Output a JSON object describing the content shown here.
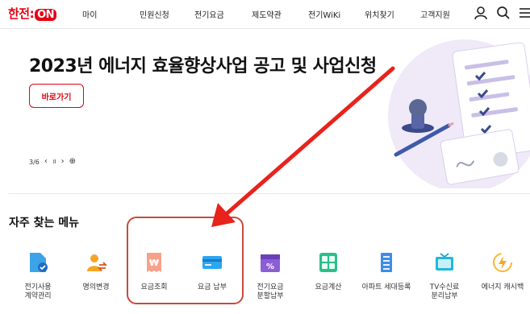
{
  "header": {
    "logo_part1": "한전:",
    "logo_part2": "ON",
    "nav": [
      "마이",
      "민원신청",
      "전기요금",
      "제도약관",
      "전기WiKi",
      "위치찾기",
      "고객지원"
    ],
    "icons": [
      "user-icon",
      "search-icon",
      "menu-icon"
    ]
  },
  "hero": {
    "title": "2023년 에너지 효율향상사업 공고 및 사업신청",
    "button_label": "바로가기",
    "slide_counter": "3/6",
    "controls": {
      "prev": "‹",
      "pause": "॥",
      "next": "›",
      "add": "⊕"
    }
  },
  "frequent_menu": {
    "title": "자주 찾는 메뉴",
    "items": [
      {
        "label": "전기사용\n계약관리",
        "icon": "document-check-icon"
      },
      {
        "label": "명의변경",
        "icon": "user-change-icon"
      },
      {
        "label": "요금조회",
        "icon": "won-receipt-icon"
      },
      {
        "label": "요금 납부",
        "icon": "credit-card-icon"
      },
      {
        "label": "전기요금\n분할납부",
        "icon": "calendar-percent-icon"
      },
      {
        "label": "요금계산",
        "icon": "calculator-icon"
      },
      {
        "label": "아파트 세대등록",
        "icon": "apartment-icon"
      },
      {
        "label": "TV수신료\n분리납부",
        "icon": "tv-icon"
      },
      {
        "label": "에너지 캐시백",
        "icon": "lightning-icon"
      }
    ]
  },
  "colors": {
    "brand": "#e60012",
    "annotation": "#e8231c",
    "highlight_border": "#c84a3a"
  }
}
